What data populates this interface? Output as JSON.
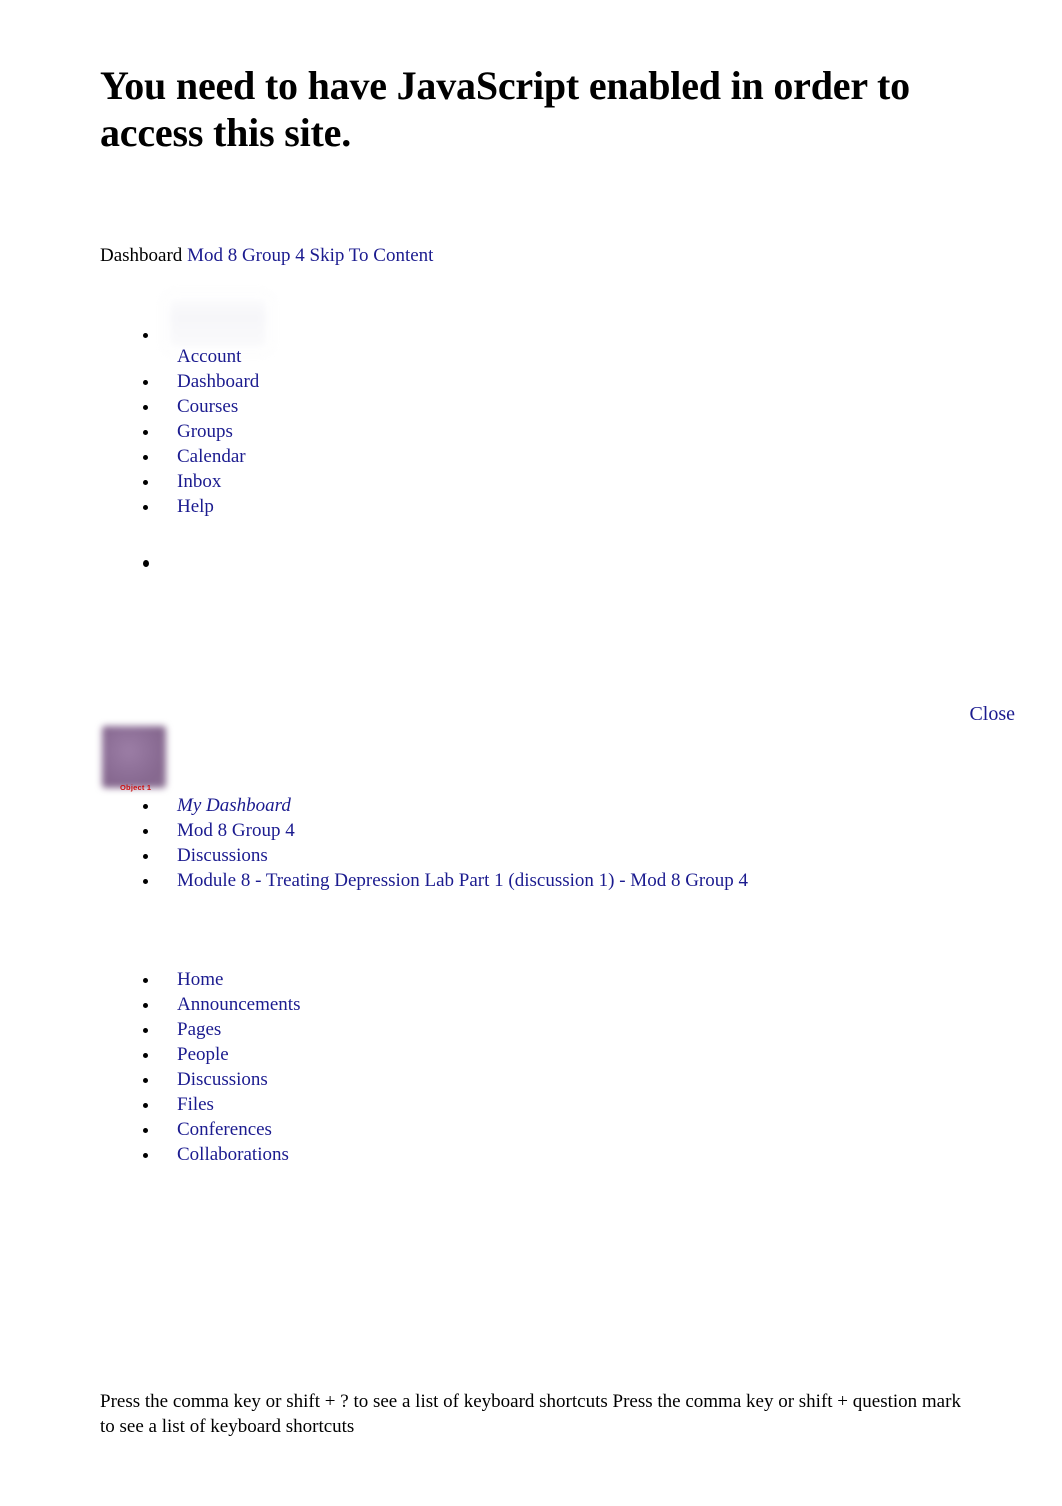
{
  "heading": "You need to have JavaScript enabled in order to access this site.",
  "top_crumbs": {
    "dashboard_plain": "Dashboard",
    "course_link": "Mod 8 Group 4",
    "skip_link": "Skip To Content"
  },
  "global_nav": {
    "items": [
      {
        "label": "Account",
        "name": "global-nav-account"
      },
      {
        "label": "Dashboard",
        "name": "global-nav-dashboard"
      },
      {
        "label": "Courses",
        "name": "global-nav-courses"
      },
      {
        "label": "Groups",
        "name": "global-nav-groups"
      },
      {
        "label": "Calendar",
        "name": "global-nav-calendar"
      },
      {
        "label": "Inbox",
        "name": "global-nav-inbox"
      },
      {
        "label": "Help",
        "name": "global-nav-help"
      }
    ]
  },
  "tray": {
    "close_label": "Close"
  },
  "object_image": {
    "caption": "Object 1"
  },
  "course_crumbs": {
    "items": [
      {
        "label": "My Dashboard"
      },
      {
        "label": "Mod 8 Group 4"
      },
      {
        "label": "Discussions"
      },
      {
        "label": "Module 8 - Treating Depression Lab Part 1 (discussion 1) - Mod 8 Group 4"
      }
    ]
  },
  "course_nav": {
    "items": [
      {
        "label": "Home"
      },
      {
        "label": "Announcements"
      },
      {
        "label": "Pages"
      },
      {
        "label": "People"
      },
      {
        "label": "Discussions"
      },
      {
        "label": "Files"
      },
      {
        "label": "Conferences"
      },
      {
        "label": "Collaborations"
      }
    ]
  },
  "footer": {
    "note": "Press the comma key or shift + ? to see a list of keyboard shortcuts Press the comma key or shift + question mark to see a list of keyboard shortcuts"
  },
  "colors": {
    "link": "#1b1b8f",
    "text": "#000000",
    "object_caption": "#cc1111",
    "object_fill": "#8d6f97"
  }
}
